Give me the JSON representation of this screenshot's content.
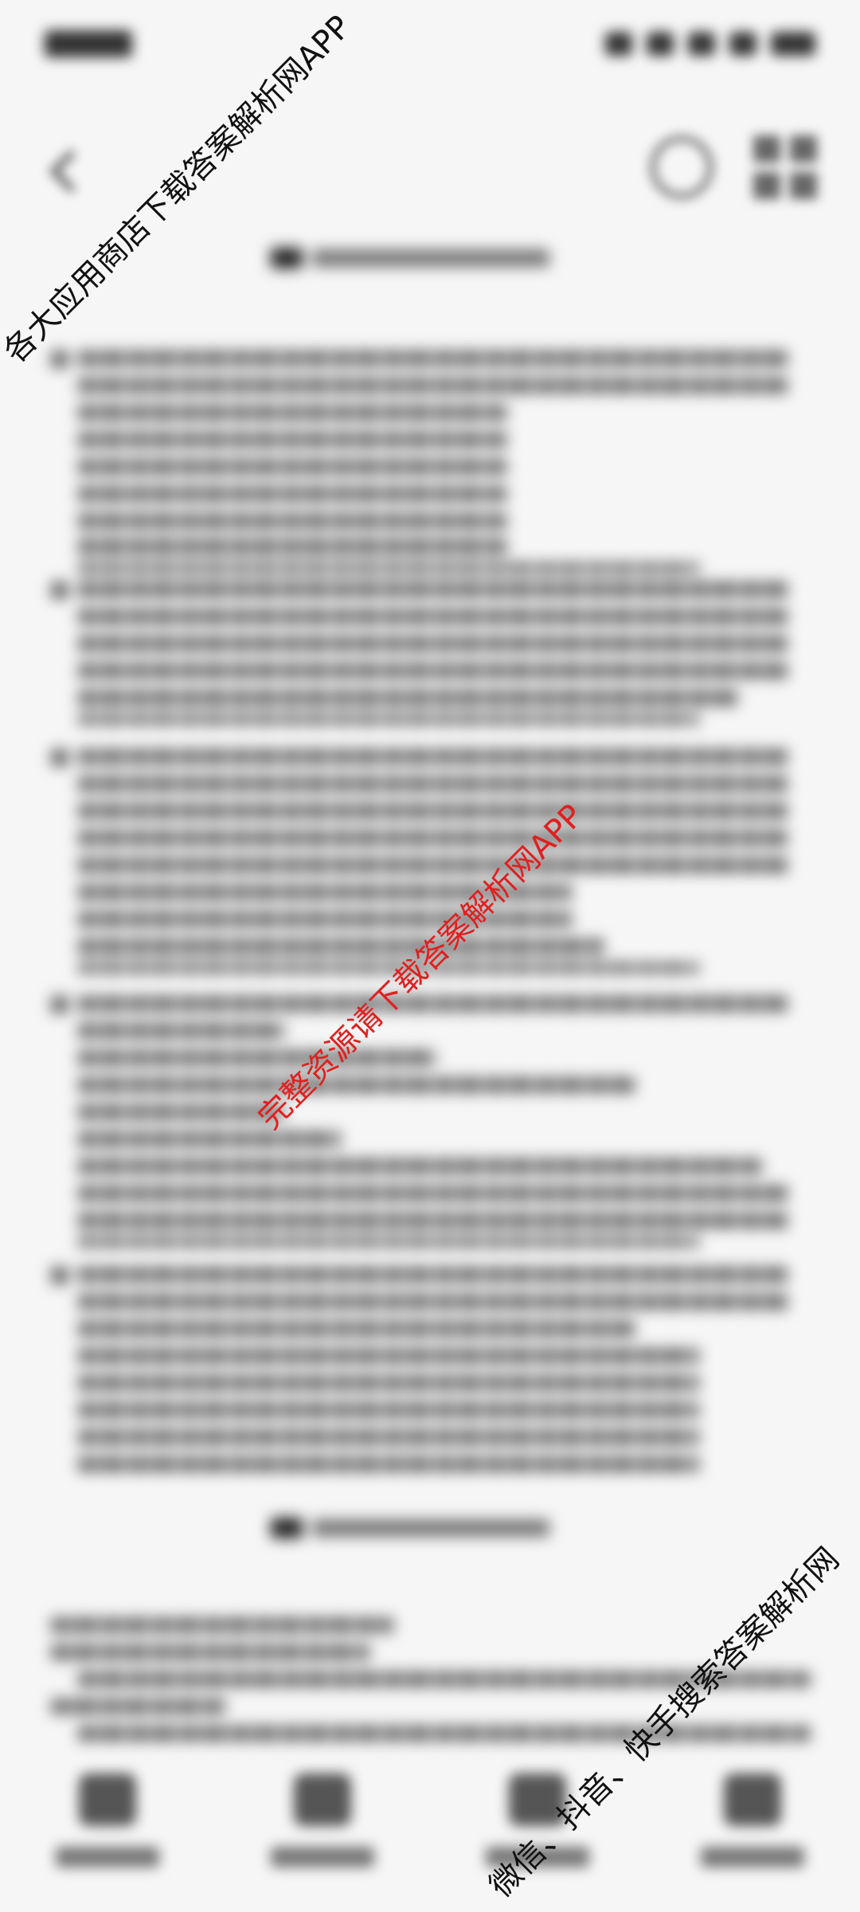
{
  "watermarks": {
    "top": "各大应用商店下载答案解析网APP",
    "center": "完整资源请下载答案解析网APP",
    "bottom": "微信、抖音、快手搜索答案解析网"
  },
  "toolbar": {
    "items": [
      {
        "icon": "home-icon"
      },
      {
        "icon": "document-icon"
      },
      {
        "icon": "grid-icon"
      },
      {
        "icon": "share-icon"
      }
    ]
  }
}
